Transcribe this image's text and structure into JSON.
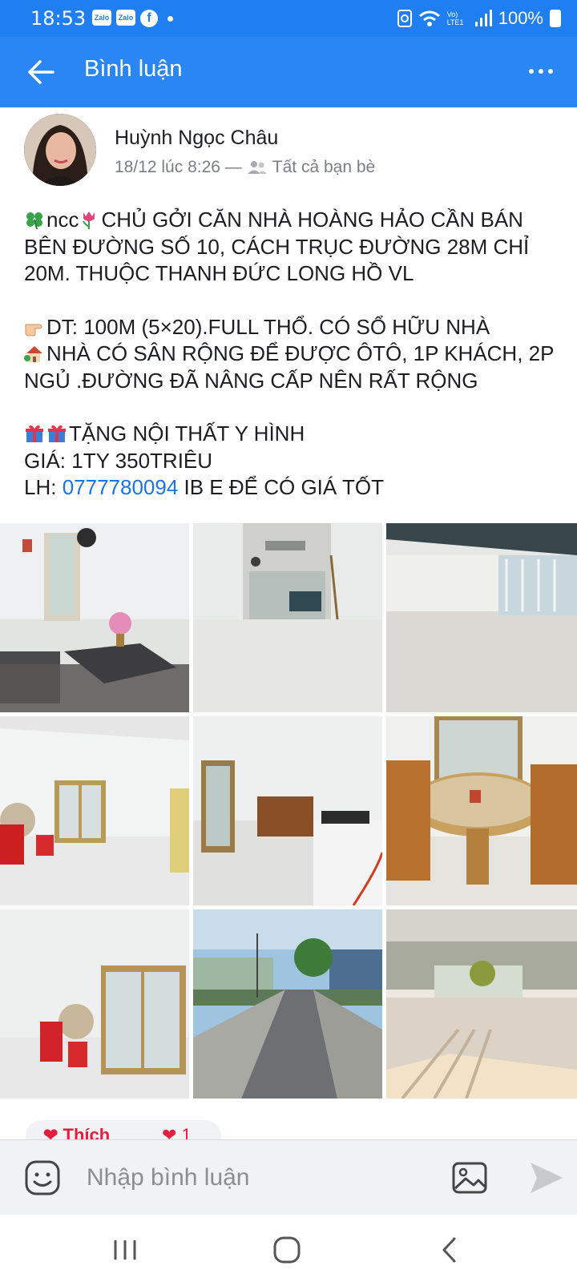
{
  "status": {
    "time": "18:53",
    "zalo_label": "Zalo",
    "network": "Vo) LTE1",
    "battery": "100%"
  },
  "app_bar": {
    "title": "Bình luận"
  },
  "post": {
    "author": "Huỳnh Ngọc Châu",
    "date": "18/12 lúc 8:26 —",
    "audience": "Tất cả bạn bè",
    "lines": [
      "ncc",
      "CHỦ GỞI CĂN NHÀ HOÀNG HẢO CẦN BÁN BÊN ĐƯỜNG SỐ 10, CÁCH TRỤC ĐƯỜNG 28M CHỈ 20M. THUỘC THANH ĐỨC LONG HỒ VL",
      "DT: 100M (5×20).FULL THỔ. CÓ SỔ HỮU NHÀ",
      "NHÀ CÓ SÂN RỘNG ĐỂ ĐƯỢC ÔTÔ, 1P KHÁCH, 2P NGỦ .ĐƯỜNG ĐÃ NÂNG CẤP NÊN RẤT RỘNG",
      "TẶNG NỘI THẤT Y HÌNH",
      "GIÁ: 1TY 350TRIÊU",
      "LH: ",
      "0777780094",
      " IB E ĐỂ CÓ GIÁ TỐT"
    ],
    "photos": [
      "living-room-photo",
      "doorway-photo",
      "terrace-photo",
      "cabinet-room-photo",
      "kitchen-photo",
      "dining-table-photo",
      "cabinet-corner-photo",
      "street-photo",
      "front-yard-photo"
    ],
    "reactions": {
      "like_label": "Thích",
      "count": "1"
    }
  },
  "comment": {
    "placeholder": "Nhập bình luận"
  },
  "colors": {
    "accent": "#2a86f3",
    "link": "#1b74e4"
  }
}
